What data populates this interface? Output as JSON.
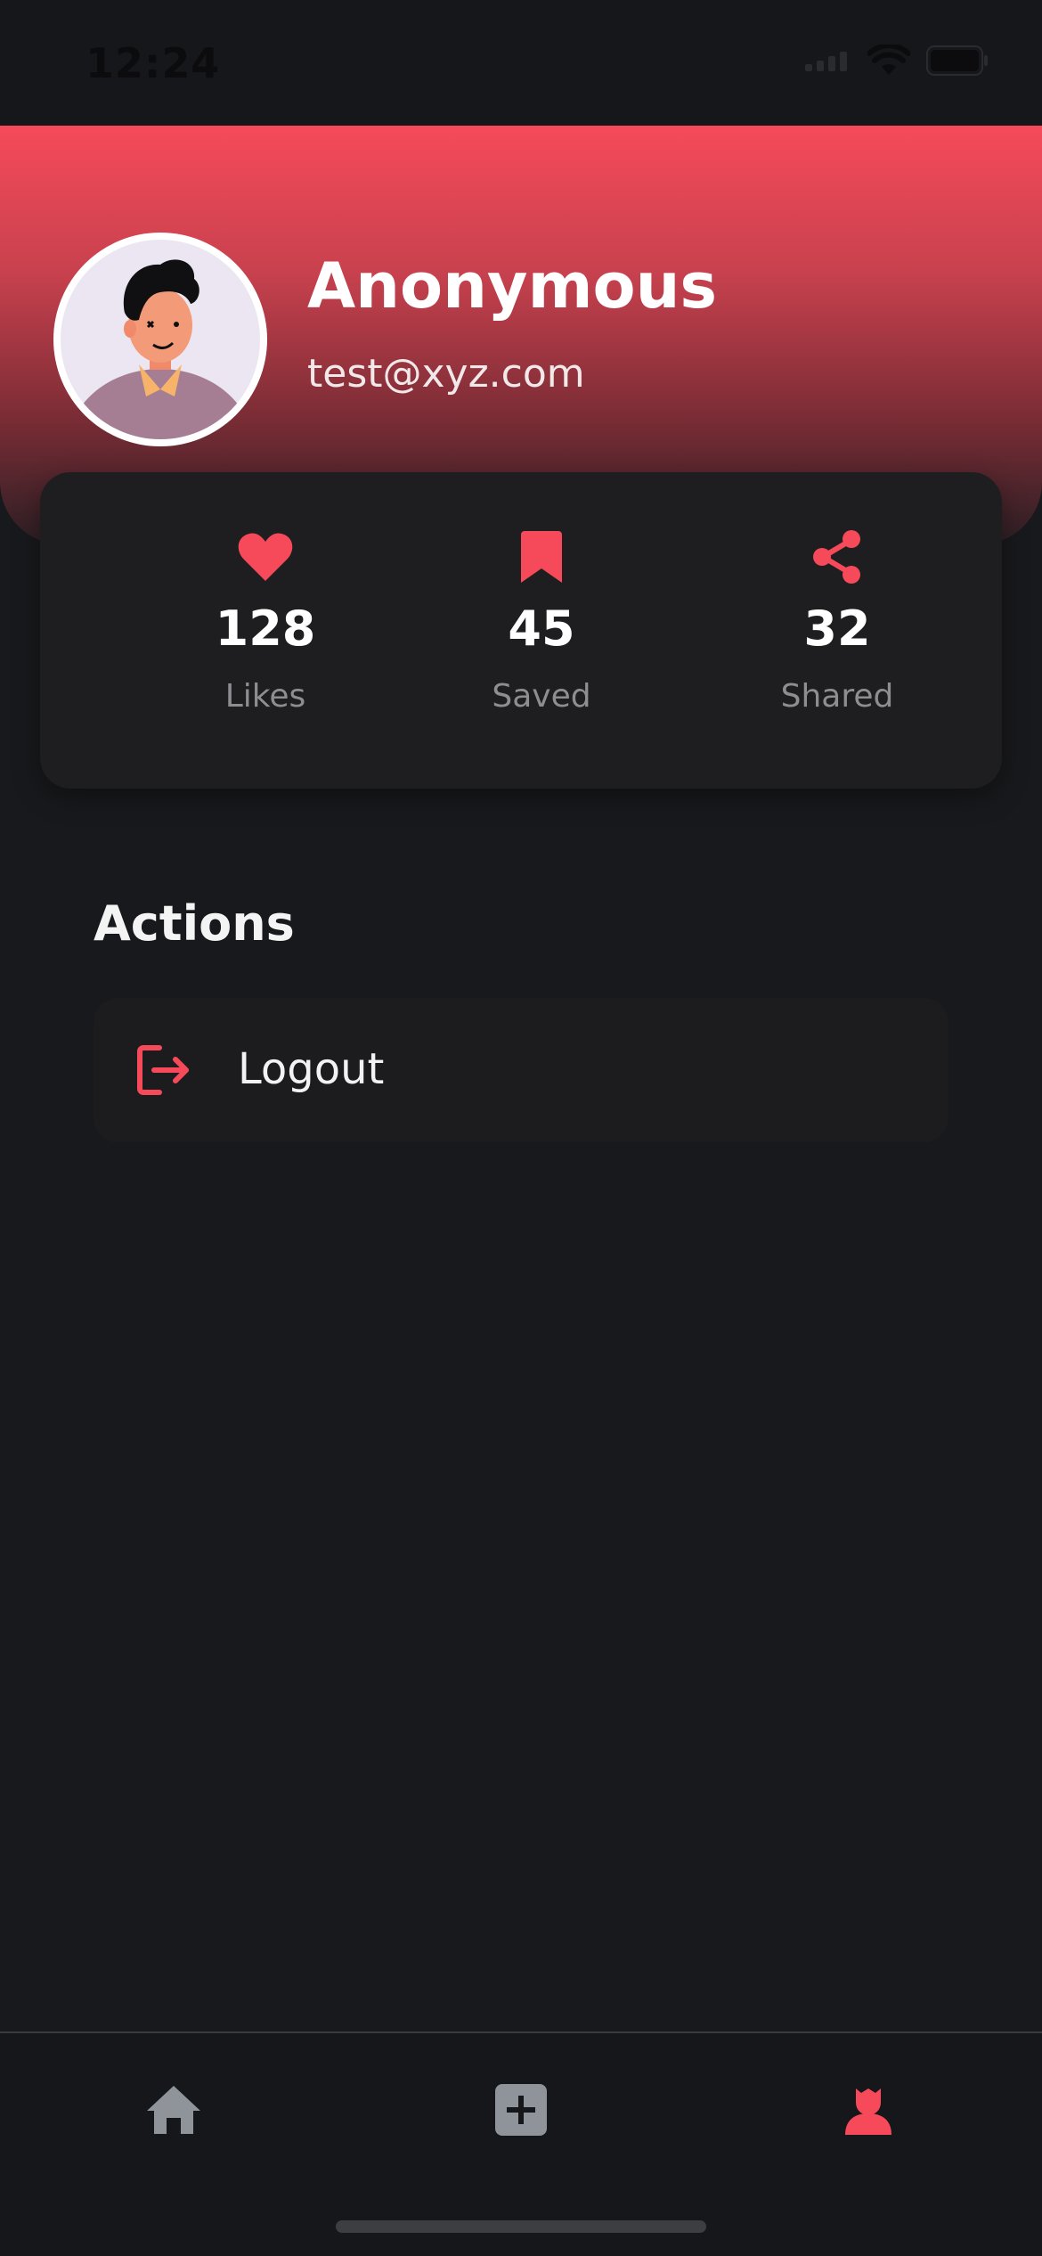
{
  "status_bar": {
    "time": "12:24"
  },
  "profile": {
    "name": "Anonymous",
    "email": "test@xyz.com"
  },
  "stats": [
    {
      "icon": "heart-icon",
      "value": "128",
      "label": "Likes"
    },
    {
      "icon": "bookmark-icon",
      "value": "45",
      "label": "Saved"
    },
    {
      "icon": "share-icon",
      "value": "32",
      "label": "Shared"
    }
  ],
  "actions": {
    "title": "Actions",
    "items": [
      {
        "icon": "logout-icon",
        "label": "Logout"
      }
    ]
  },
  "bottom_nav": {
    "items": [
      {
        "icon": "home-icon",
        "active": false
      },
      {
        "icon": "add-icon",
        "active": false
      },
      {
        "icon": "profile-icon",
        "active": true
      }
    ]
  },
  "colors": {
    "accent": "#f64a5a",
    "background": "#18191c",
    "card": "#1e1e20",
    "inactive_icon": "#8f949b",
    "muted_text": "#8d8d92"
  }
}
